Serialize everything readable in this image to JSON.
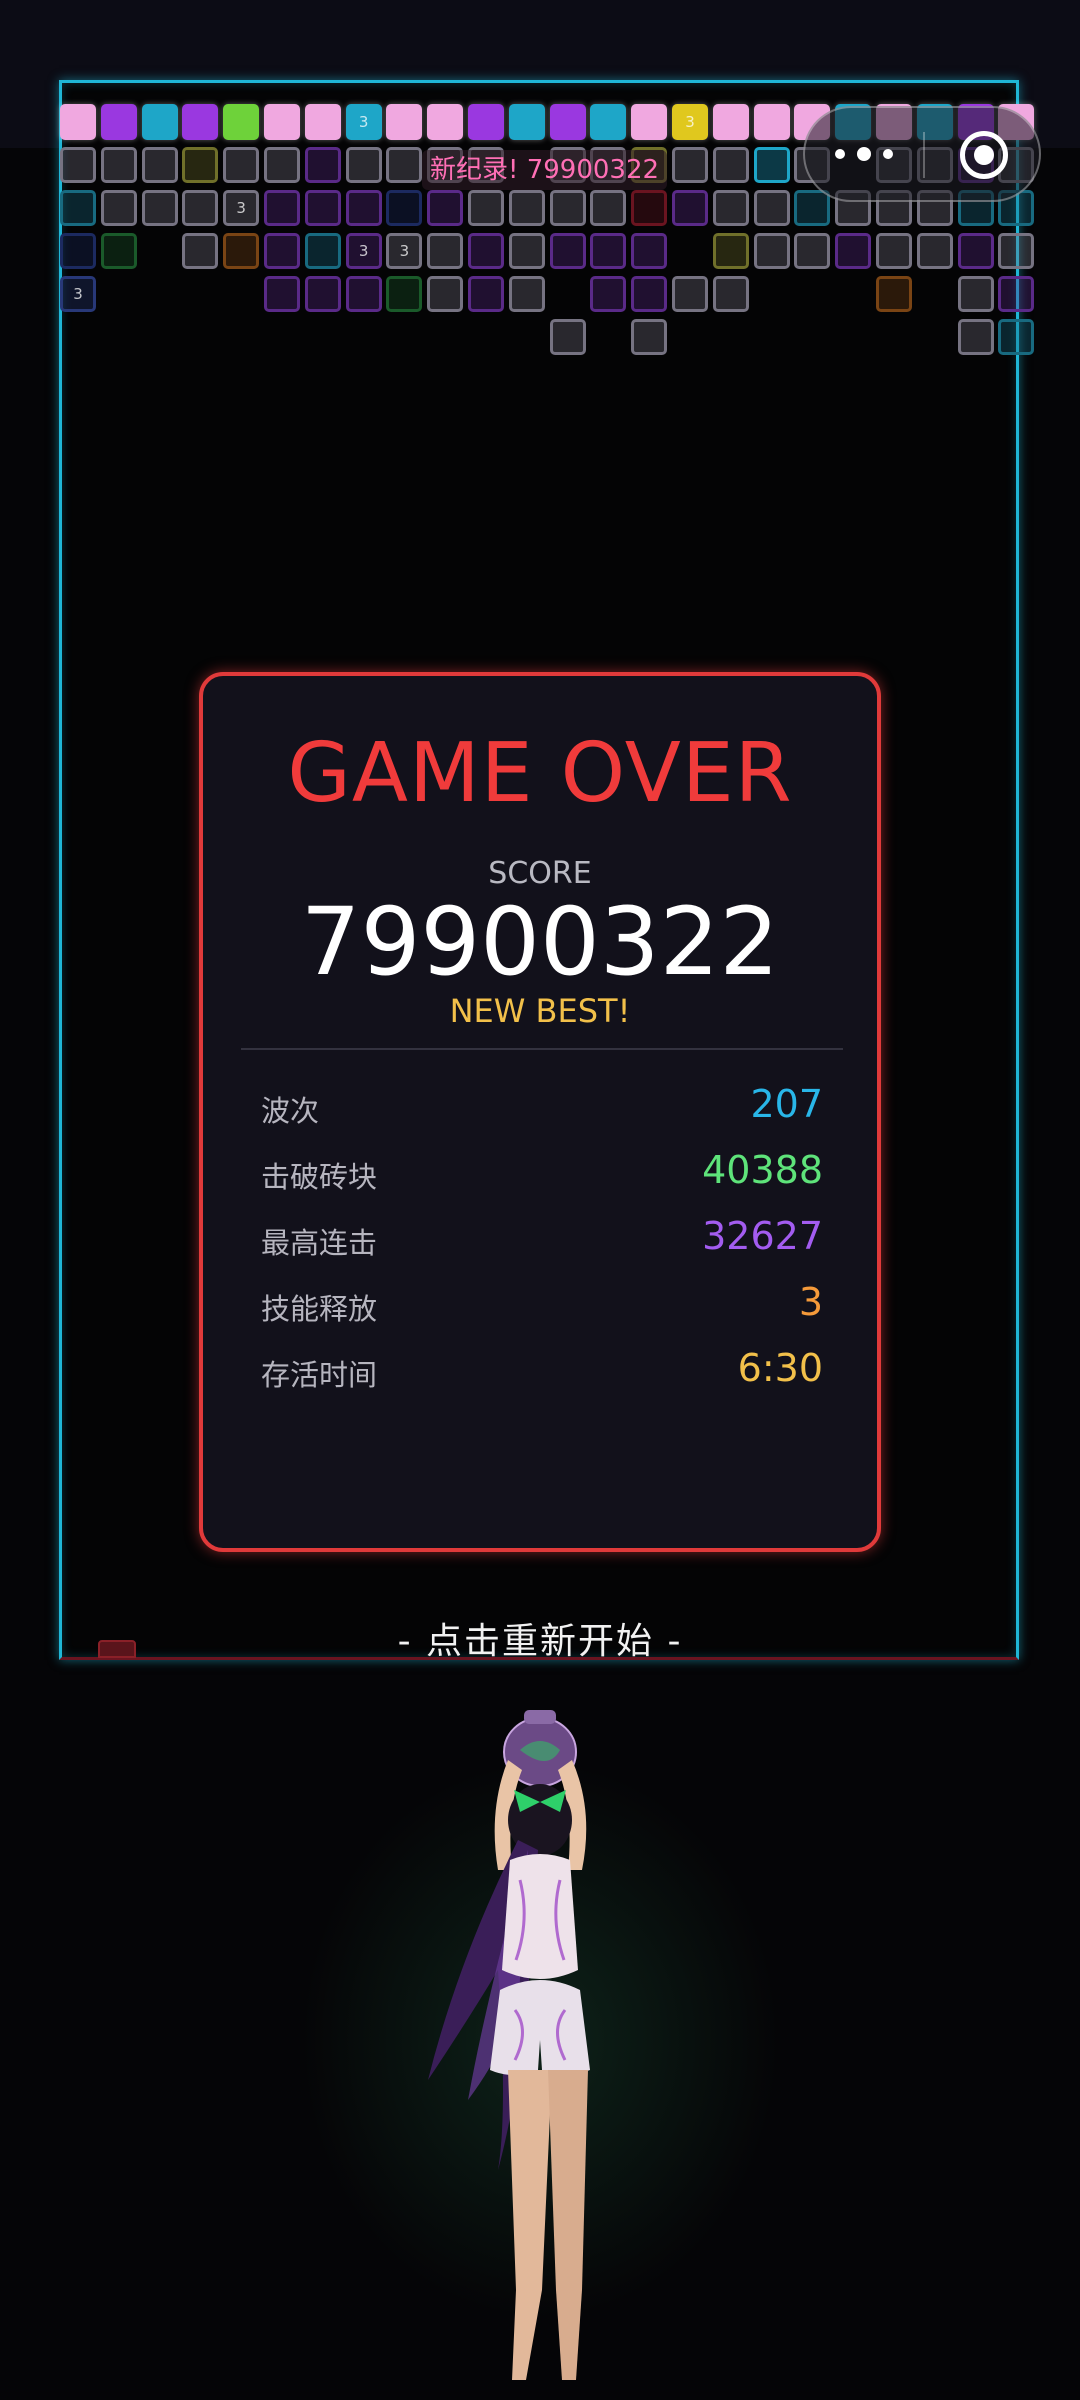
{
  "game": {
    "record_banner": "新纪录! 79900322",
    "restart_hint": "- 点击重新开始 -"
  },
  "top_controls": {
    "more_icon": "more-dots-icon",
    "close_icon": "target-close-icon"
  },
  "game_over_panel": {
    "title": "GAME OVER",
    "score_label": "SCORE",
    "score_value": "79900322",
    "best_label": "NEW BEST!",
    "stats": [
      {
        "label": "波次",
        "value": "207",
        "color": "#29b6e8"
      },
      {
        "label": "击破砖块",
        "value": "40388",
        "color": "#5ee37a"
      },
      {
        "label": "最高连击",
        "value": "32627",
        "color": "#a35cf0"
      },
      {
        "label": "技能释放",
        "value": "3",
        "color": "#f59a3a"
      },
      {
        "label": "存活时间",
        "value": "6:30",
        "color": "#f2c04a"
      }
    ]
  },
  "colors": {
    "frame": "#1fb6d6",
    "panel_border": "#e03a3a",
    "title": "#f03b3b",
    "best": "#f2c04a",
    "record": "#ff6fb5"
  },
  "bricks": {
    "marker_text": "3",
    "palette": {
      "P": "#f0a8e0",
      "V": "#9a38e0",
      "C": "#1ea6c8",
      "G": "#6ed23a",
      "Y": "#e0c81e",
      "g": "#767382",
      "v": "#5a2a88",
      "c": "#186a80",
      "n": "#1c2a60",
      "r": "#6a1420",
      "e": "#1a5a2a",
      "o": "#7a4414",
      "y": "#70702a",
      "d": "#283878"
    },
    "rows": [
      "PVCVGPPCPPVCVCPYPPPCPCVP",
      "gggyggvgggg.ggyggCg.ggvg",
      "cggggvvvnvggggrvggcgggcc",
      "ne.govcvggvgvvv.yggvggvg",
      "d....vvvegvg.vvgg...o.gvc",
      "............g.g.......gc"
    ],
    "row_starts": [
      0,
      0,
      0,
      0,
      0,
      0
    ]
  }
}
